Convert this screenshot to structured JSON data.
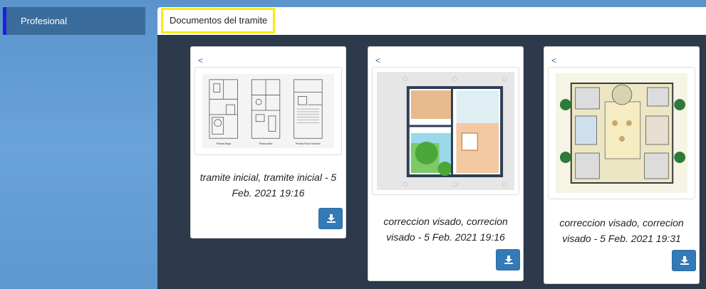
{
  "sidebar": {
    "items": [
      {
        "label": "Profesional"
      }
    ]
  },
  "header": {
    "title": "Documentos del tramite"
  },
  "documents": [
    {
      "prev_label": "<",
      "caption": "tramite inicial, tramite inicial - 5 Feb. 2021 19:16",
      "plan_labels": [
        "Planta Baja",
        "Planta Alta",
        "Planta Roof Garden"
      ]
    },
    {
      "prev_label": "<",
      "caption": "correccion visado, correcion visado - 5 Feb. 2021 19:16"
    },
    {
      "prev_label": "<",
      "caption": "correccion visado, correcion visado - 5 Feb. 2021 19:31"
    }
  ],
  "icons": {
    "download": "download-icon",
    "previous": "chevron-left"
  },
  "colors": {
    "accent": "#337ab7",
    "highlight": "#f5ec16",
    "panel": "#2c3a4c"
  }
}
